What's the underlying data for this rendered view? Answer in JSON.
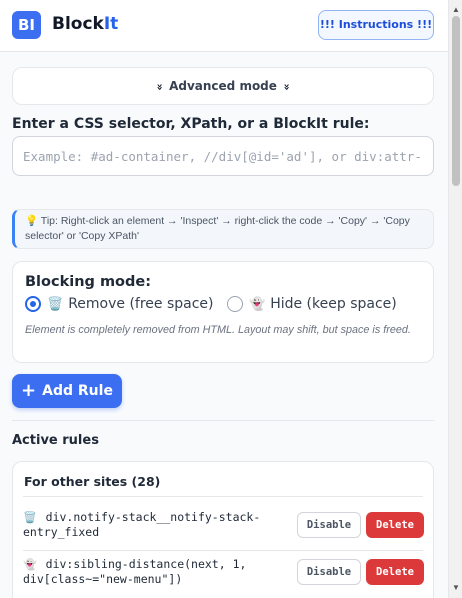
{
  "header": {
    "logo_text": "BI",
    "brand_prefix": "Block",
    "brand_suffix": "It",
    "instructions_label": "!!! Instructions !!!"
  },
  "advanced": {
    "label": "Advanced mode",
    "chevron": "»"
  },
  "selector": {
    "label": "Enter a CSS selector, XPath, or a BlockIt rule:",
    "placeholder": "Example: #ad-container, //div[@id='ad'], or div:attr-"
  },
  "tip": {
    "text": "💡 Tip: Right-click an element → 'Inspect' → right-click the code → 'Copy' → 'Copy selector' or 'Copy XPath'"
  },
  "blocking_mode": {
    "title": "Blocking mode:",
    "options": [
      {
        "emoji": "🗑️",
        "label": "Remove (free space)",
        "checked": true
      },
      {
        "emoji": "👻",
        "label": "Hide (keep space)",
        "checked": false
      }
    ],
    "description": "Element is completely removed from HTML. Layout may shift, but space is freed."
  },
  "add_rule": {
    "icon": "+",
    "label": "Add Rule"
  },
  "active_rules": {
    "title": "Active rules",
    "group_title": "For other sites (28)",
    "rules": [
      {
        "emoji": "🗑️",
        "selector": "div.notify-stack__notify-stack-entry_fixed",
        "disable_label": "Disable",
        "delete_label": "Delete"
      },
      {
        "emoji": "👻",
        "selector": "div:sibling-distance(next, 1, div[class~=\"new-menu\"])",
        "disable_label": "Disable",
        "delete_label": "Delete"
      }
    ]
  },
  "colors": {
    "accent": "#3b6ef0",
    "delete": "#dc3a3a",
    "tip_border": "#3b82f6"
  }
}
